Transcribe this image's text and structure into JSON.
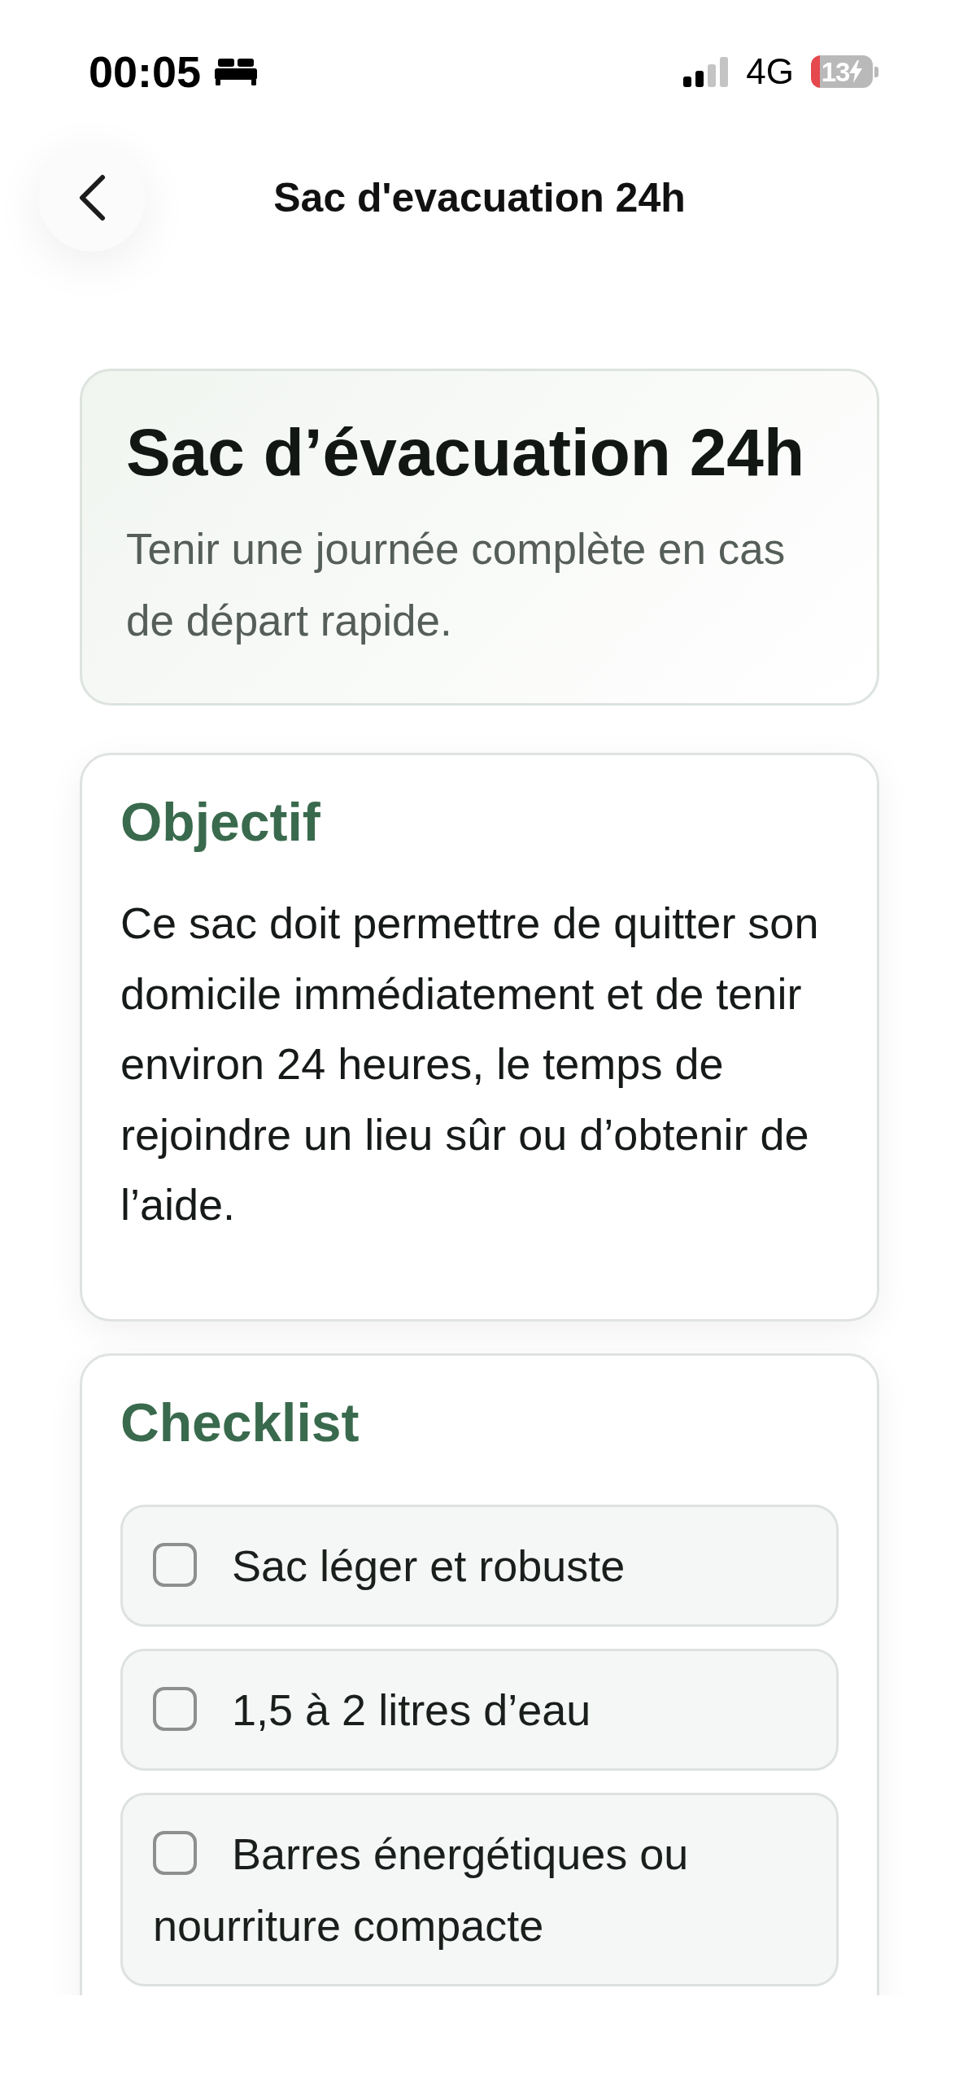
{
  "status_bar": {
    "time": "00:05",
    "network": "4G",
    "battery": "13"
  },
  "header": {
    "title": "Sac d'evacuation 24h"
  },
  "hero": {
    "title": "Sac d’évacuation 24h",
    "subtitle": "Tenir une journée complète en cas de départ rapide."
  },
  "sections": [
    {
      "kind": "text",
      "title": "Objectif",
      "body": "Ce sac doit permettre de quitter son domicile immédiatement et de tenir environ 24 heures, le temps de rejoindre un lieu sûr ou d’obtenir de l’aide."
    },
    {
      "kind": "checklist",
      "title": "Checklist",
      "items": [
        {
          "label": "Sac léger et robuste",
          "checked": false
        },
        {
          "label": "1,5 à 2 litres d’eau",
          "checked": false
        },
        {
          "label": "Barres énergétiques ou nourriture compacte",
          "checked": false
        }
      ]
    }
  ]
}
